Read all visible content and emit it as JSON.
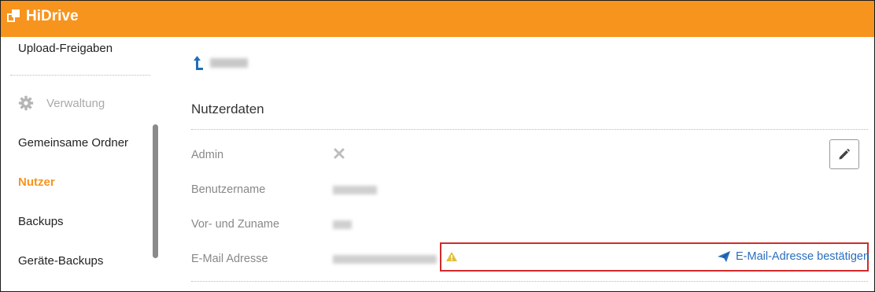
{
  "app": {
    "brand": "HiDrive",
    "accent": "#f7941d",
    "link_color": "#2a6ebd",
    "highlight_color": "#d12a2a"
  },
  "sidebar": {
    "items": [
      {
        "label": "Upload-Freigaben"
      },
      {
        "label": "Gemeinsame Ordner"
      },
      {
        "label": "Nutzer",
        "active": true
      },
      {
        "label": "Backups"
      },
      {
        "label": "Geräte-Backups"
      }
    ],
    "section_heading": "Verwaltung",
    "section_icon": "gear-icon"
  },
  "main": {
    "back_icon": "arrow-up-icon",
    "section_title": "Nutzerdaten",
    "edit_icon": "pencil-icon",
    "fields": [
      {
        "label": "Admin",
        "value_icon": "x-icon"
      },
      {
        "label": "Benutzername"
      },
      {
        "label": "Vor- und Zuname"
      },
      {
        "label": "E-Mail Adresse",
        "status_icon": "warning-icon"
      }
    ],
    "confirm_email_label": "E-Mail-Adresse bestätigen",
    "confirm_email_icon": "paper-plane-icon"
  }
}
